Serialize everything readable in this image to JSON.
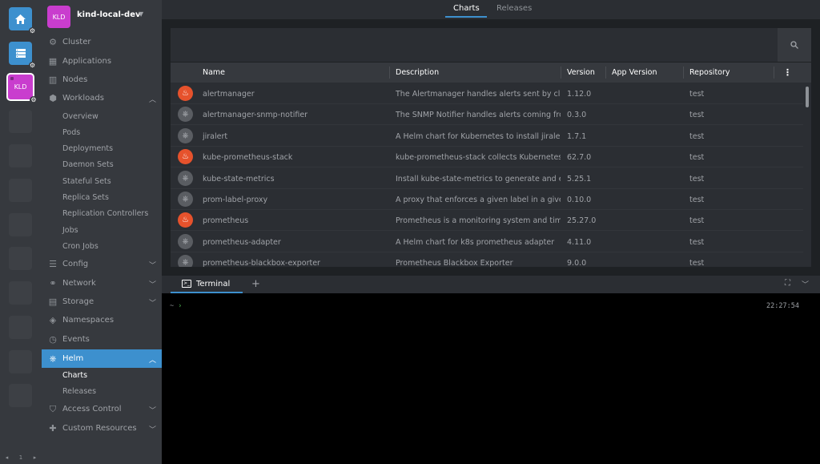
{
  "hotbar": {
    "active_label": "KLD",
    "page_number": "1"
  },
  "sidebar": {
    "avatar": "KLD",
    "cluster_name": "kind-local-dev",
    "items": [
      {
        "label": "Cluster",
        "icon": "cluster-icon"
      },
      {
        "label": "Applications",
        "icon": "apps-icon"
      },
      {
        "label": "Nodes",
        "icon": "nodes-icon"
      },
      {
        "label": "Workloads",
        "icon": "workloads-icon"
      },
      {
        "label": "Config",
        "icon": "config-icon"
      },
      {
        "label": "Network",
        "icon": "network-icon"
      },
      {
        "label": "Storage",
        "icon": "storage-icon"
      },
      {
        "label": "Namespaces",
        "icon": "namespaces-icon"
      },
      {
        "label": "Events",
        "icon": "events-icon"
      },
      {
        "label": "Helm",
        "icon": "helm-icon"
      },
      {
        "label": "Access Control",
        "icon": "shield-icon"
      },
      {
        "label": "Custom Resources",
        "icon": "puzzle-icon"
      }
    ],
    "workloads_sub": [
      "Overview",
      "Pods",
      "Deployments",
      "Daemon Sets",
      "Stateful Sets",
      "Replica Sets",
      "Replication Controllers",
      "Jobs",
      "Cron Jobs"
    ],
    "helm_sub": [
      "Charts",
      "Releases"
    ]
  },
  "main": {
    "tabs": [
      "Charts",
      "Releases"
    ],
    "active_tab": "Charts",
    "columns": [
      "Name",
      "Description",
      "Version",
      "App Version",
      "Repository"
    ],
    "rows": [
      {
        "icon": "prometheus",
        "name": "alertmanager",
        "description": "The Alertmanager handles alerts sent by clie",
        "version": "1.12.0",
        "app_version": "",
        "repository": "test"
      },
      {
        "icon": "helm",
        "name": "alertmanager-snmp-notifier",
        "description": "The SNMP Notifier handles alerts coming fro",
        "version": "0.3.0",
        "app_version": "",
        "repository": "test"
      },
      {
        "icon": "helm",
        "name": "jiralert",
        "description": "A Helm chart for Kubernetes to install jiralert",
        "version": "1.7.1",
        "app_version": "",
        "repository": "test"
      },
      {
        "icon": "prometheus",
        "name": "kube-prometheus-stack",
        "description": "kube-prometheus-stack collects Kubernetes",
        "version": "62.7.0",
        "app_version": "",
        "repository": "test"
      },
      {
        "icon": "helm",
        "name": "kube-state-metrics",
        "description": "Install kube-state-metrics to generate and ex",
        "version": "5.25.1",
        "app_version": "",
        "repository": "test"
      },
      {
        "icon": "helm",
        "name": "prom-label-proxy",
        "description": "A proxy that enforces a given label in a given",
        "version": "0.10.0",
        "app_version": "",
        "repository": "test"
      },
      {
        "icon": "prometheus",
        "name": "prometheus",
        "description": "Prometheus is a monitoring system and time",
        "version": "25.27.0",
        "app_version": "",
        "repository": "test"
      },
      {
        "icon": "helm",
        "name": "prometheus-adapter",
        "description": "A Helm chart for k8s prometheus adapter",
        "version": "4.11.0",
        "app_version": "",
        "repository": "test"
      },
      {
        "icon": "helm",
        "name": "prometheus-blackbox-exporter",
        "description": "Prometheus Blackbox Exporter",
        "version": "9.0.0",
        "app_version": "",
        "repository": "test"
      }
    ]
  },
  "terminal": {
    "tab_label": "Terminal",
    "prompt": "~",
    "time": "22:27:54"
  },
  "colors": {
    "accent": "#3d90ce",
    "cluster": "#c93dce",
    "prometheus": "#e6522c"
  }
}
